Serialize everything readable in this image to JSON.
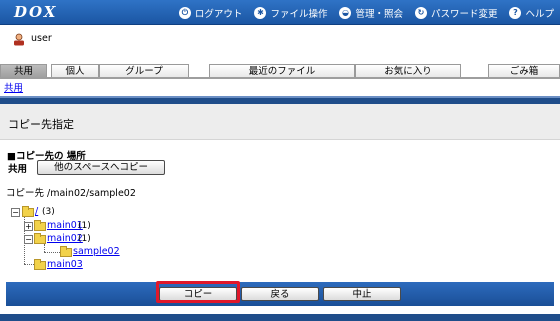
{
  "header": {
    "logo": "DOX",
    "nav": [
      {
        "label": "ログアウト",
        "icon": "logout-icon"
      },
      {
        "label": "ファイル操作",
        "icon": "gear-icon"
      },
      {
        "label": "管理・照会",
        "icon": "admin-icon"
      },
      {
        "label": "パスワード変更",
        "icon": "refresh-icon"
      },
      {
        "label": "ヘルプ",
        "icon": "help-icon"
      }
    ]
  },
  "user": {
    "name": "user",
    "icon": "user-icon"
  },
  "tabs": [
    "共用",
    "個人",
    "グループ",
    "最近のファイル",
    "お気に入り",
    "ごみ箱"
  ],
  "breadcrumb": "共用",
  "page_title": "コピー先指定",
  "place": {
    "heading": "■コピー先の 場所",
    "label": "共用",
    "button": "他のスペースへコピー"
  },
  "destination": "コピー先 /main02/sample02",
  "tree": {
    "root": {
      "name": "/",
      "count": "(3)"
    },
    "children": [
      {
        "name": "main01",
        "count": "(1)"
      },
      {
        "name": "main02",
        "count": "(1)"
      },
      {
        "name": "sample02",
        "count": ""
      },
      {
        "name": "main03",
        "count": ""
      }
    ]
  },
  "actions": {
    "copy": "コピー",
    "back": "戻る",
    "cancel": "中止"
  },
  "colors": {
    "header_blue": "#1b56a3",
    "highlight": "#e0182a",
    "folder": "#f2d24a"
  }
}
